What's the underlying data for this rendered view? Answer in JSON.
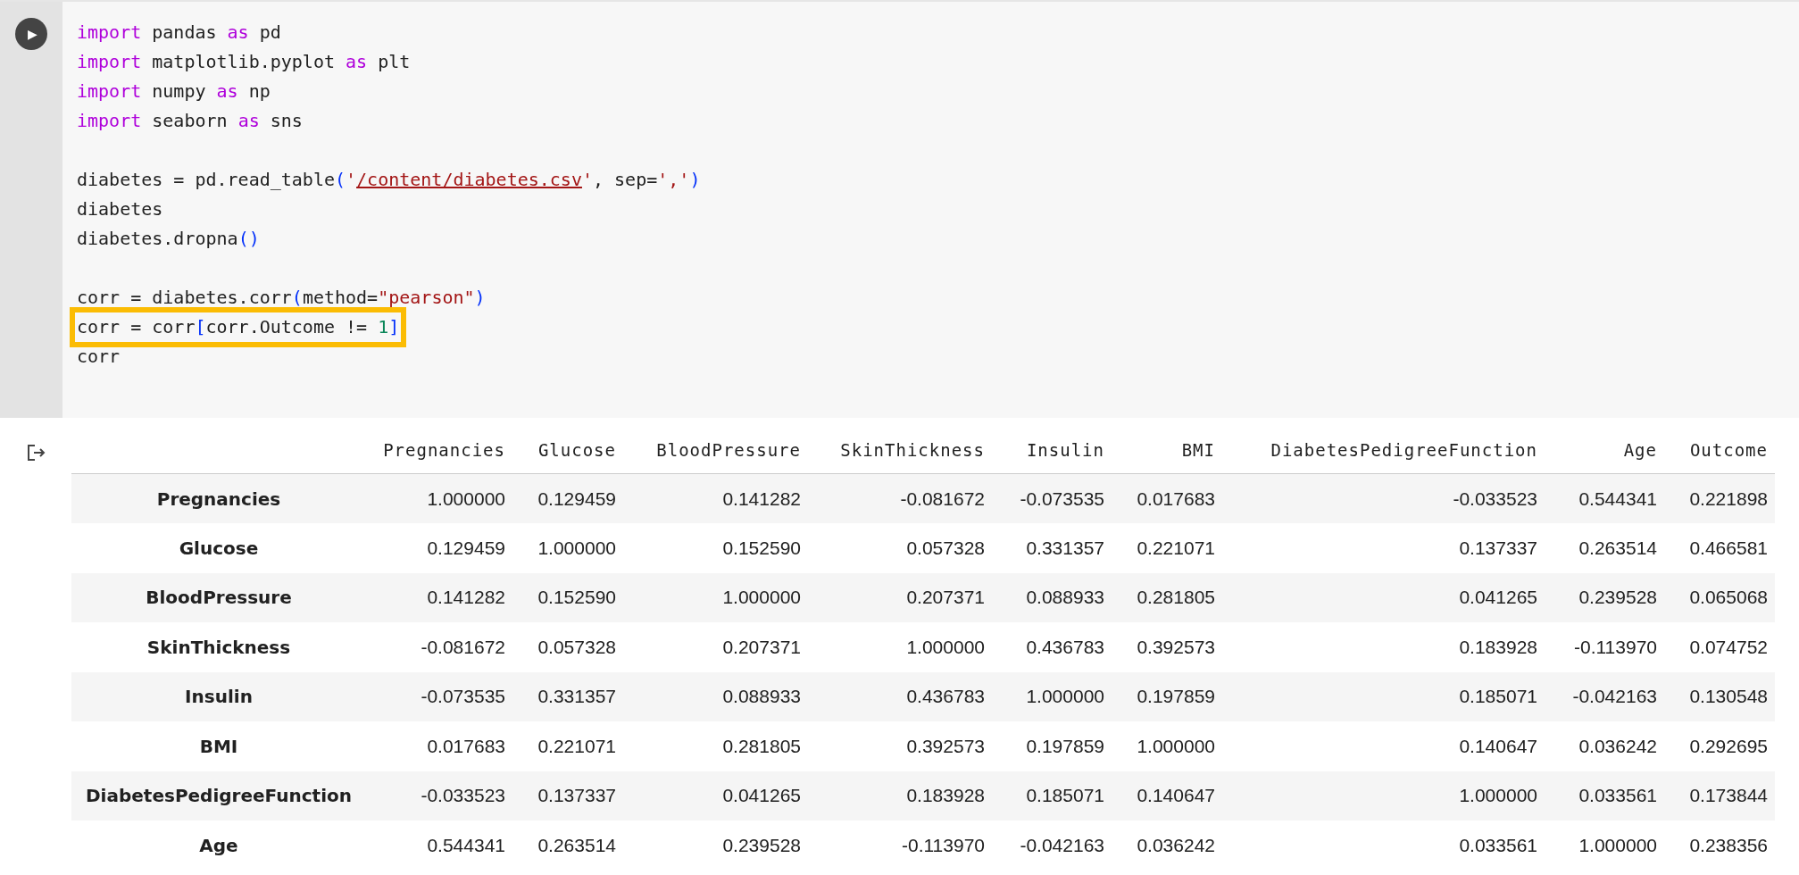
{
  "cell": {
    "run_button": {
      "glyph": "▶"
    },
    "code_lines": [
      {
        "highlighted": false,
        "tokens": [
          {
            "kind": "keyword",
            "text": "import"
          },
          {
            "kind": "plain",
            "text": " pandas "
          },
          {
            "kind": "keyword",
            "text": "as"
          },
          {
            "kind": "plain",
            "text": " pd"
          }
        ]
      },
      {
        "highlighted": false,
        "tokens": [
          {
            "kind": "keyword",
            "text": "import"
          },
          {
            "kind": "plain",
            "text": " matplotlib.pyplot "
          },
          {
            "kind": "keyword",
            "text": "as"
          },
          {
            "kind": "plain",
            "text": " plt"
          }
        ]
      },
      {
        "highlighted": false,
        "tokens": [
          {
            "kind": "keyword",
            "text": "import"
          },
          {
            "kind": "plain",
            "text": " numpy "
          },
          {
            "kind": "keyword",
            "text": "as"
          },
          {
            "kind": "plain",
            "text": " np"
          }
        ]
      },
      {
        "highlighted": false,
        "tokens": [
          {
            "kind": "keyword",
            "text": "import"
          },
          {
            "kind": "plain",
            "text": " seaborn "
          },
          {
            "kind": "keyword",
            "text": "as"
          },
          {
            "kind": "plain",
            "text": " sns"
          }
        ]
      },
      {
        "kind": "blank"
      },
      {
        "highlighted": false,
        "tokens": [
          {
            "kind": "plain",
            "text": "diabetes = pd.read_table"
          },
          {
            "kind": "bracket",
            "text": "("
          },
          {
            "kind": "string",
            "text": "'"
          },
          {
            "kind": "link",
            "text": "/content/diabetes.csv"
          },
          {
            "kind": "string",
            "text": "'"
          },
          {
            "kind": "plain",
            "text": ", sep="
          },
          {
            "kind": "string",
            "text": "','"
          },
          {
            "kind": "bracket",
            "text": ")"
          }
        ]
      },
      {
        "highlighted": false,
        "tokens": [
          {
            "kind": "plain",
            "text": "diabetes"
          }
        ]
      },
      {
        "highlighted": false,
        "tokens": [
          {
            "kind": "plain",
            "text": "diabetes.dropna"
          },
          {
            "kind": "bracket",
            "text": "()"
          }
        ]
      },
      {
        "kind": "blank"
      },
      {
        "highlighted": false,
        "tokens": [
          {
            "kind": "plain",
            "text": "corr = diabetes.corr"
          },
          {
            "kind": "bracket",
            "text": "("
          },
          {
            "kind": "plain",
            "text": "method="
          },
          {
            "kind": "string",
            "text": "\"pearson\""
          },
          {
            "kind": "bracket",
            "text": ")"
          }
        ]
      },
      {
        "highlighted": true,
        "tokens": [
          {
            "kind": "plain",
            "text": "corr = corr"
          },
          {
            "kind": "bracket",
            "text": "["
          },
          {
            "kind": "plain",
            "text": "corr.Outcome != "
          },
          {
            "kind": "number",
            "text": "1"
          },
          {
            "kind": "bracket",
            "text": "]"
          }
        ]
      },
      {
        "highlighted": false,
        "tokens": [
          {
            "kind": "plain",
            "text": "corr"
          }
        ]
      }
    ]
  },
  "output": {
    "table": {
      "columns": [
        "Pregnancies",
        "Glucose",
        "BloodPressure",
        "SkinThickness",
        "Insulin",
        "BMI",
        "DiabetesPedigreeFunction",
        "Age",
        "Outcome"
      ],
      "rows": [
        {
          "index": "Pregnancies",
          "cells": [
            "1.000000",
            "0.129459",
            "0.141282",
            "-0.081672",
            "-0.073535",
            "0.017683",
            "-0.033523",
            "0.544341",
            "0.221898"
          ]
        },
        {
          "index": "Glucose",
          "cells": [
            "0.129459",
            "1.000000",
            "0.152590",
            "0.057328",
            "0.331357",
            "0.221071",
            "0.137337",
            "0.263514",
            "0.466581"
          ]
        },
        {
          "index": "BloodPressure",
          "cells": [
            "0.141282",
            "0.152590",
            "1.000000",
            "0.207371",
            "0.088933",
            "0.281805",
            "0.041265",
            "0.239528",
            "0.065068"
          ]
        },
        {
          "index": "SkinThickness",
          "cells": [
            "-0.081672",
            "0.057328",
            "0.207371",
            "1.000000",
            "0.436783",
            "0.392573",
            "0.183928",
            "-0.113970",
            "0.074752"
          ]
        },
        {
          "index": "Insulin",
          "cells": [
            "-0.073535",
            "0.331357",
            "0.088933",
            "0.436783",
            "1.000000",
            "0.197859",
            "0.185071",
            "-0.042163",
            "0.130548"
          ]
        },
        {
          "index": "BMI",
          "cells": [
            "0.017683",
            "0.221071",
            "0.281805",
            "0.392573",
            "0.197859",
            "1.000000",
            "0.140647",
            "0.036242",
            "0.292695"
          ]
        },
        {
          "index": "DiabetesPedigreeFunction",
          "cells": [
            "-0.033523",
            "0.137337",
            "0.041265",
            "0.183928",
            "0.185071",
            "0.140647",
            "1.000000",
            "0.033561",
            "0.173844"
          ]
        },
        {
          "index": "Age",
          "cells": [
            "0.544341",
            "0.263514",
            "0.239528",
            "-0.113970",
            "-0.042163",
            "0.036242",
            "0.033561",
            "1.000000",
            "0.238356"
          ]
        }
      ]
    }
  }
}
